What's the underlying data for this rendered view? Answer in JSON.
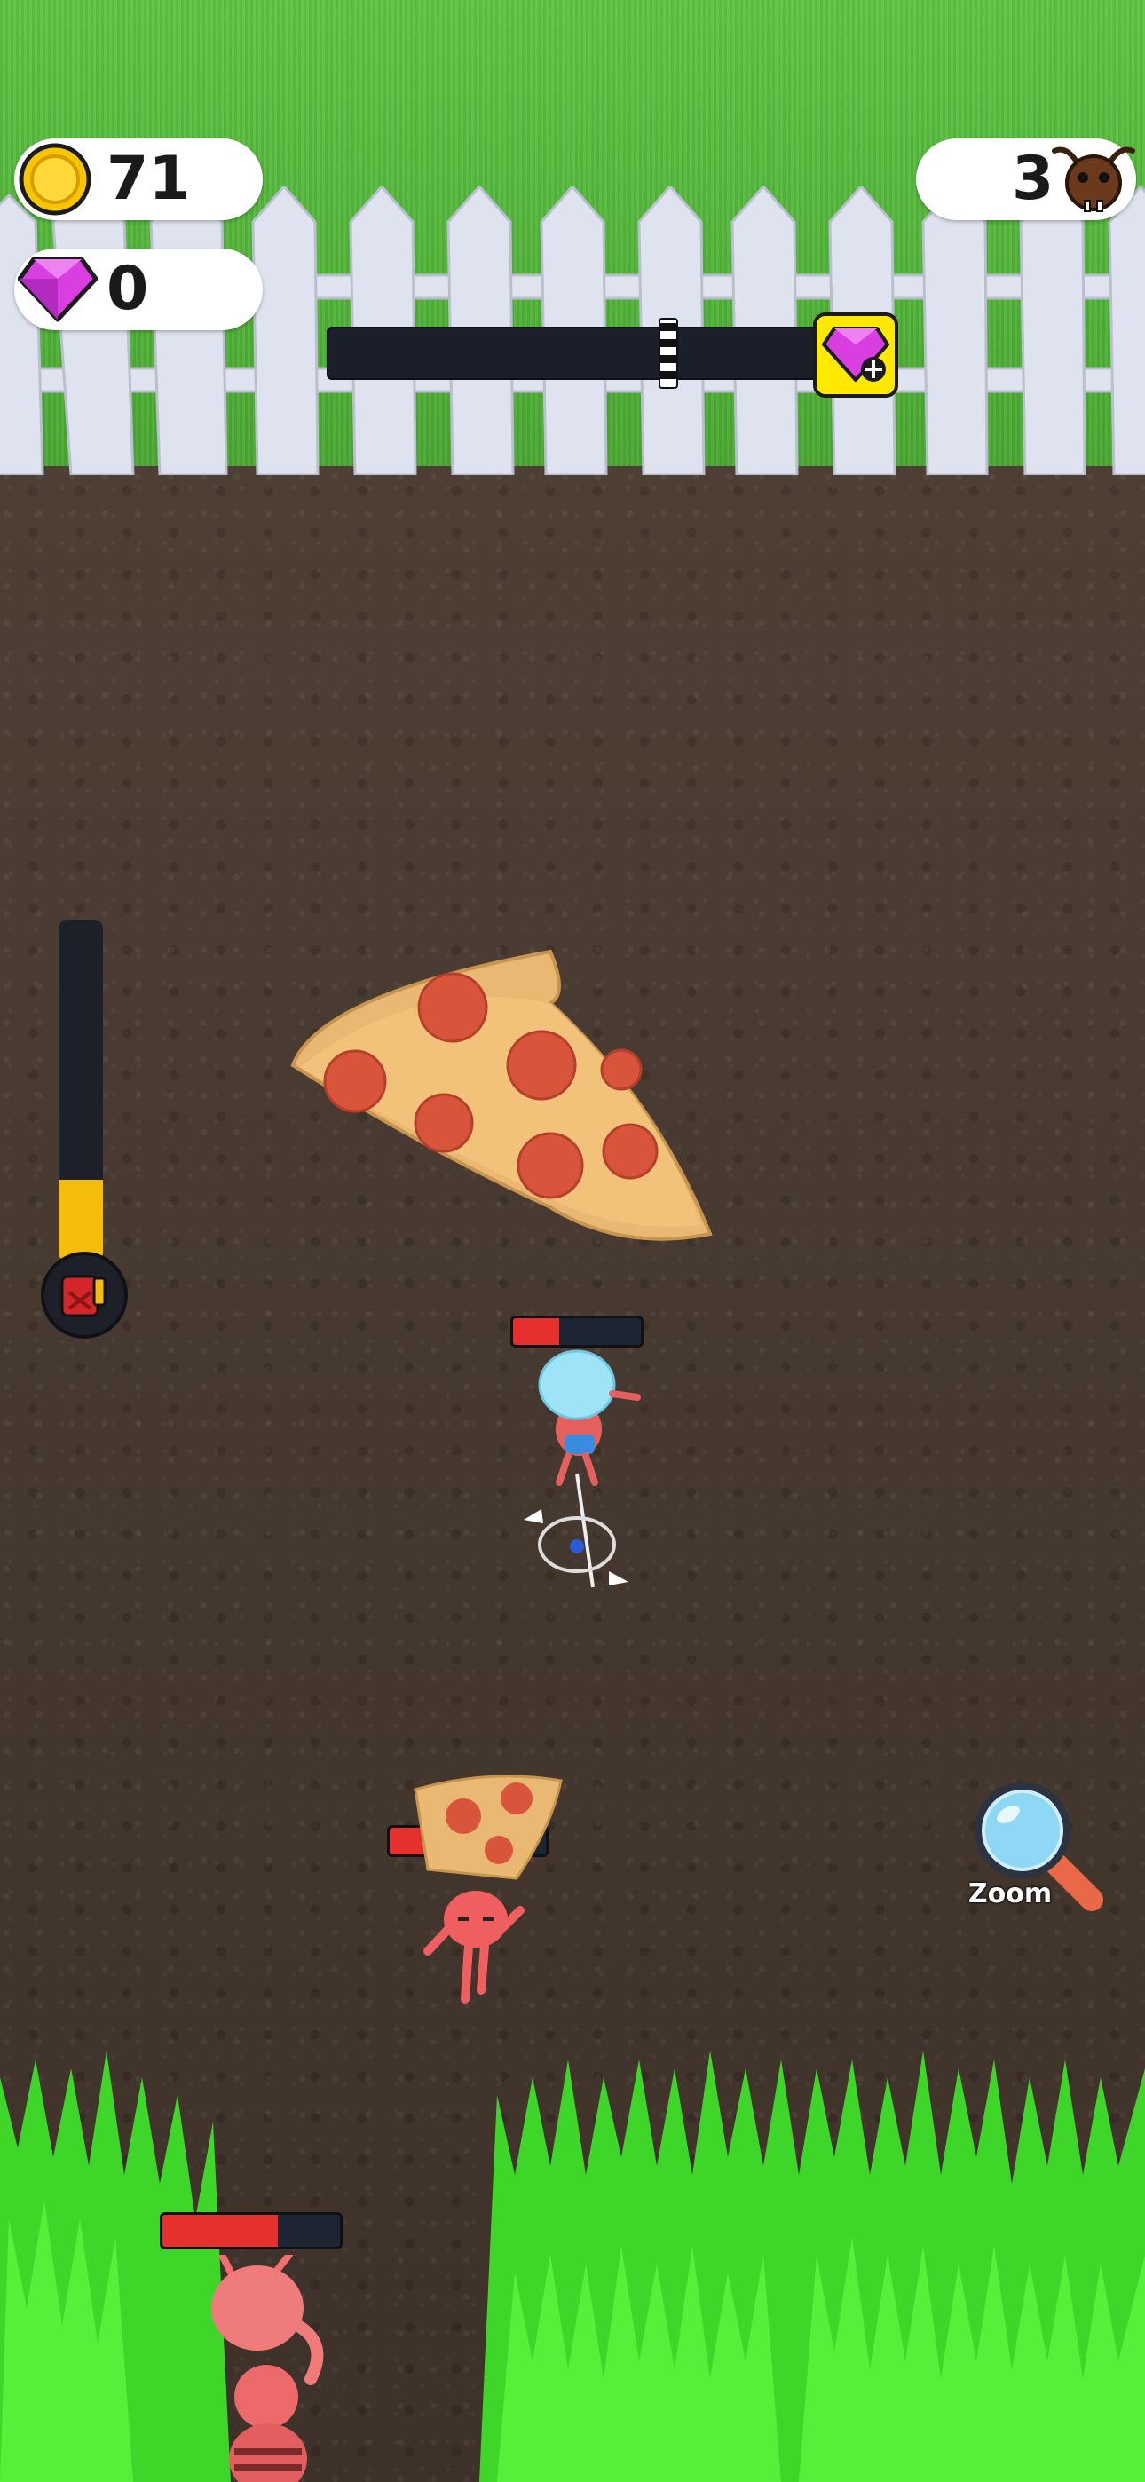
{
  "hud": {
    "coins": "71",
    "gems": "0",
    "ants": "3"
  },
  "level_progress": {
    "fraction": 0.6,
    "reward_icon": "gem-plus-icon"
  },
  "fuel": {
    "fraction": 0.24,
    "icon": "fuel-can-icon"
  },
  "health_bars": {
    "player": 0.36,
    "enemy_ant_1": 0.6,
    "enemy_ant_2": 0.65
  },
  "zoom": {
    "label": "Zoom",
    "icon": "magnifier-icon"
  },
  "colors": {
    "coin": "#f7c600",
    "gem": "#d93fe0",
    "progress_reward_bg": "#ffe900",
    "fuel": "#f5bd0b",
    "health": "#e5302e"
  }
}
